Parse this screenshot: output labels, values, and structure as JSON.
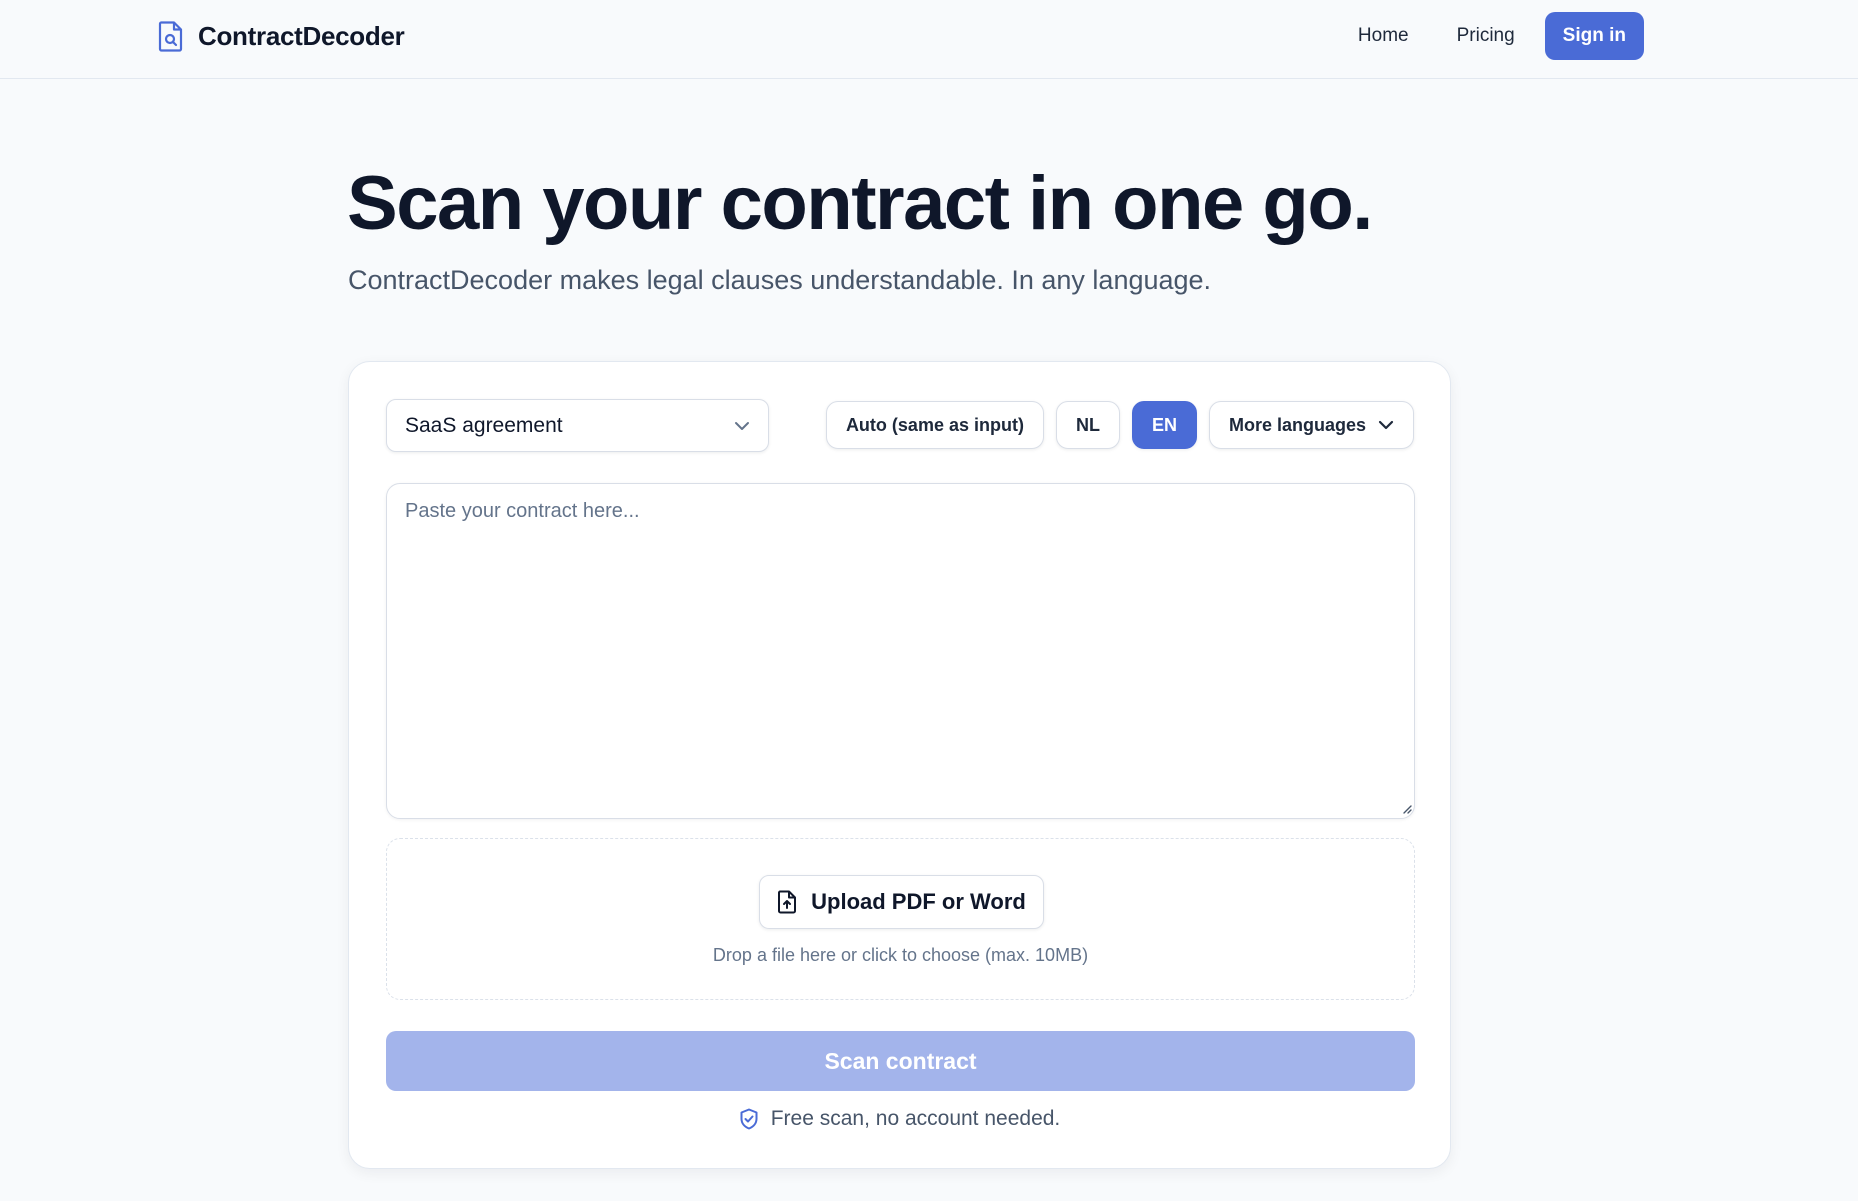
{
  "header": {
    "brand_name": "ContractDecoder",
    "brand_icon": "document-search-icon",
    "nav": {
      "home": "Home",
      "pricing": "Pricing",
      "sign_in": "Sign in"
    }
  },
  "hero": {
    "title": "Scan your contract in one go.",
    "subtitle": "ContractDecoder makes legal clauses understandable. In any language."
  },
  "form": {
    "contract_type": {
      "selected": "SaaS agreement",
      "icon": "chevron-down-icon"
    },
    "languages": {
      "auto": "Auto (same as input)",
      "nl": "NL",
      "en": "EN",
      "selected": "EN",
      "more": "More languages"
    },
    "textarea": {
      "placeholder": "Paste your contract here...",
      "value": ""
    },
    "upload": {
      "button_label": "Upload PDF or Word",
      "icon": "file-upload-icon",
      "hint": "Drop a file here or click to choose (max. 10MB)"
    },
    "scan_button": "Scan contract",
    "free_note": "Free scan, no account needed.",
    "free_note_icon": "shield-check-icon"
  },
  "colors": {
    "accent": "#4a6bd6",
    "accent_disabled": "#a3b4eb",
    "page_bg": "#f8fafc",
    "text_dark": "#0f172a",
    "text_muted": "#475569"
  }
}
